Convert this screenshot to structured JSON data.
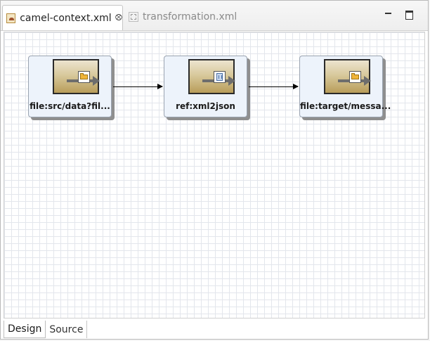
{
  "editor": {
    "tabs": [
      {
        "label": "camel-context.xml",
        "icon": "camel-context-file-icon",
        "active": true
      },
      {
        "label": "transformation.xml",
        "icon": "xml-file-icon",
        "active": false
      }
    ],
    "close_symbol": "⮾"
  },
  "diagram": {
    "nodes": [
      {
        "label": "file:src/data?fil...",
        "icon": "folder-icon",
        "type": "endpoint"
      },
      {
        "label": "ref:xml2json",
        "icon": "bean-icon",
        "type": "bean"
      },
      {
        "label": "file:target/messa...",
        "icon": "folder-icon",
        "type": "endpoint"
      }
    ],
    "connections": [
      {
        "from": 0,
        "to": 1
      },
      {
        "from": 1,
        "to": 2
      }
    ]
  },
  "bottom_tabs": [
    {
      "label": "Design",
      "active": true
    },
    {
      "label": "Source",
      "active": false
    }
  ]
}
